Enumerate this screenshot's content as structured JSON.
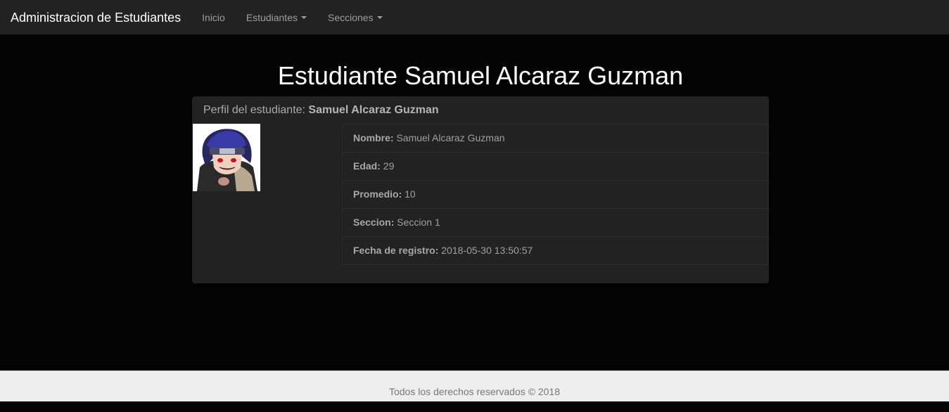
{
  "navbar": {
    "brand": "Administracion de Estudiantes",
    "items": [
      {
        "label": "Inicio",
        "dropdown": false
      },
      {
        "label": "Estudiantes",
        "dropdown": true
      },
      {
        "label": "Secciones",
        "dropdown": true
      }
    ]
  },
  "page": {
    "title": "Estudiante Samuel Alcaraz Guzman"
  },
  "panel": {
    "heading_prefix": "Perfil del estudiante: ",
    "heading_name": "Samuel Alcaraz Guzman",
    "fields": [
      {
        "label": "Nombre:",
        "value": "Samuel Alcaraz Guzman"
      },
      {
        "label": "Edad:",
        "value": "29"
      },
      {
        "label": "Promedio:",
        "value": "10"
      },
      {
        "label": "Seccion:",
        "value": "Seccion 1"
      },
      {
        "label": "Fecha de registro:",
        "value": "2018-05-30 13:50:57"
      }
    ]
  },
  "footer": {
    "text": "Todos los derechos reservados © 2018"
  },
  "colors": {
    "navbar_bg": "#222222",
    "page_bg": "#030303",
    "panel_bg": "#222222",
    "footer_bg": "#eeeeee"
  }
}
